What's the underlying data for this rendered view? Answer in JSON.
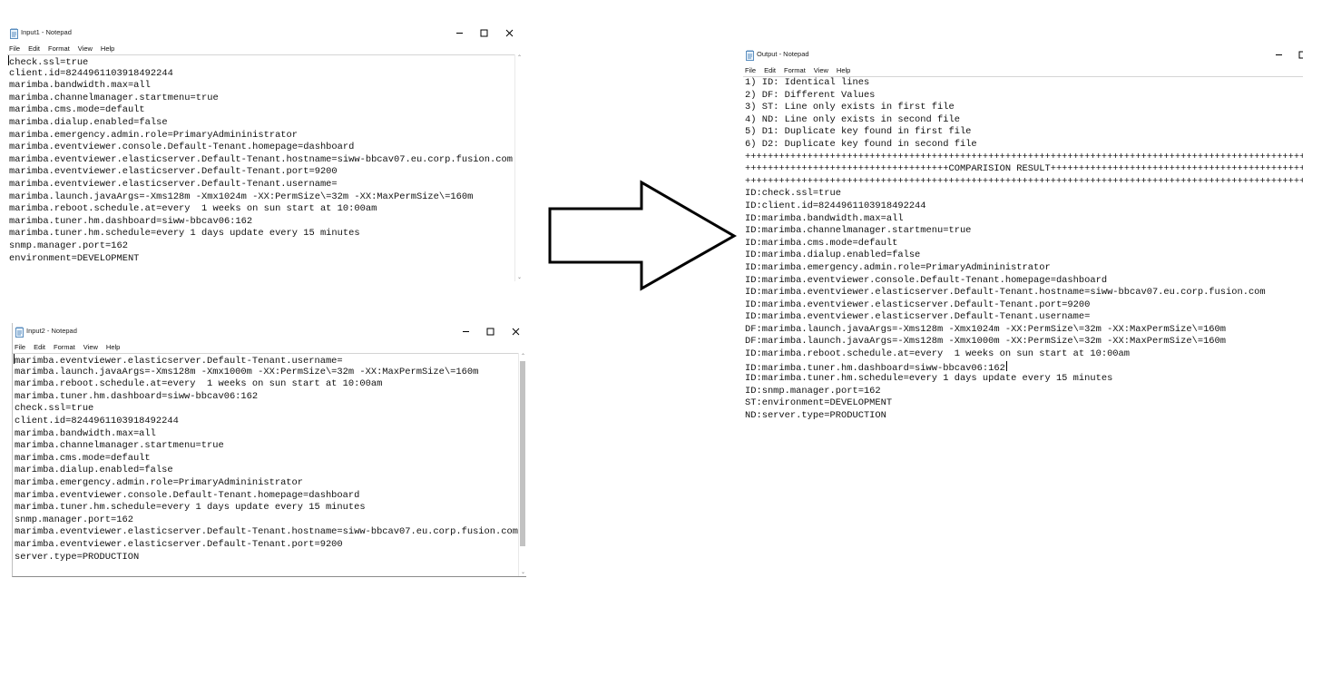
{
  "input1": {
    "title": "Input1 - Notepad",
    "menu": [
      "File",
      "Edit",
      "Format",
      "View",
      "Help"
    ],
    "lines": [
      "check.ssl=true",
      "client.id=8244961103918492244",
      "marimba.bandwidth.max=all",
      "marimba.channelmanager.startmenu=true",
      "marimba.cms.mode=default",
      "marimba.dialup.enabled=false",
      "marimba.emergency.admin.role=PrimaryAdmininistrator",
      "marimba.eventviewer.console.Default-Tenant.homepage=dashboard",
      "marimba.eventviewer.elasticserver.Default-Tenant.hostname=siww-bbcav07.eu.corp.fusion.com",
      "marimba.eventviewer.elasticserver.Default-Tenant.port=9200",
      "marimba.eventviewer.elasticserver.Default-Tenant.username=",
      "marimba.launch.javaArgs=-Xms128m -Xmx1024m -XX:PermSize\\=32m -XX:MaxPermSize\\=160m",
      "marimba.reboot.schedule.at=every  1 weeks on sun start at 10:00am",
      "marimba.tuner.hm.dashboard=siww-bbcav06:162",
      "marimba.tuner.hm.schedule=every 1 days update every 15 minutes",
      "snmp.manager.port=162",
      "environment=DEVELOPMENT"
    ]
  },
  "input2": {
    "title": "Input2 - Notepad",
    "menu": [
      "File",
      "Edit",
      "Format",
      "View",
      "Help"
    ],
    "lines": [
      "marimba.eventviewer.elasticserver.Default-Tenant.username=",
      "marimba.launch.javaArgs=-Xms128m -Xmx1000m -XX:PermSize\\=32m -XX:MaxPermSize\\=160m",
      "marimba.reboot.schedule.at=every  1 weeks on sun start at 10:00am",
      "marimba.tuner.hm.dashboard=siww-bbcav06:162",
      "check.ssl=true",
      "client.id=8244961103918492244",
      "marimba.bandwidth.max=all",
      "marimba.channelmanager.startmenu=true",
      "marimba.cms.mode=default",
      "marimba.dialup.enabled=false",
      "marimba.emergency.admin.role=PrimaryAdmininistrator",
      "marimba.eventviewer.console.Default-Tenant.homepage=dashboard",
      "marimba.tuner.hm.schedule=every 1 days update every 15 minutes",
      "snmp.manager.port=162",
      "marimba.eventviewer.elasticserver.Default-Tenant.hostname=siww-bbcav07.eu.corp.fusion.com",
      "marimba.eventviewer.elasticserver.Default-Tenant.port=9200",
      "server.type=PRODUCTION"
    ]
  },
  "output": {
    "title": "Output - Notepad",
    "menu": [
      "File",
      "Edit",
      "Format",
      "View",
      "Help"
    ],
    "lines": [
      "1) ID: Identical lines",
      "2) DF: Different Values",
      "3) ST: Line only exists in first file",
      "4) ND: Line only exists in second file",
      "5) D1: Duplicate key found in first file",
      "6) D2: Duplicate key found in second file",
      "++++++++++++++++++++++++++++++++++++++++++++++++++++++++++++++++++++++++++++++++++++++++++++++++++++",
      "++++++++++++++++++++++++++++++++++++COMPARISION RESULT+++++++++++++++++++++++++++++++++++++++++++++++",
      "++++++++++++++++++++++++++++++++++++++++++++++++++++++++++++++++++++++++++++++++++++++++++++++++++++",
      "ID:check.ssl=true",
      "ID:client.id=8244961103918492244",
      "ID:marimba.bandwidth.max=all",
      "ID:marimba.channelmanager.startmenu=true",
      "ID:marimba.cms.mode=default",
      "ID:marimba.dialup.enabled=false",
      "ID:marimba.emergency.admin.role=PrimaryAdmininistrator",
      "ID:marimba.eventviewer.console.Default-Tenant.homepage=dashboard",
      "ID:marimba.eventviewer.elasticserver.Default-Tenant.hostname=siww-bbcav07.eu.corp.fusion.com",
      "ID:marimba.eventviewer.elasticserver.Default-Tenant.port=9200",
      "ID:marimba.eventviewer.elasticserver.Default-Tenant.username=",
      "DF:marimba.launch.javaArgs=-Xms128m -Xmx1024m -XX:PermSize\\=32m -XX:MaxPermSize\\=160m",
      "DF:marimba.launch.javaArgs=-Xms128m -Xmx1000m -XX:PermSize\\=32m -XX:MaxPermSize\\=160m",
      "ID:marimba.reboot.schedule.at=every  1 weeks on sun start at 10:00am",
      "ID:marimba.tuner.hm.dashboard=siww-bbcav06:162",
      "ID:marimba.tuner.hm.schedule=every 1 days update every 15 minutes",
      "ID:snmp.manager.port=162",
      "ST:environment=DEVELOPMENT",
      "ND:server.type=PRODUCTION"
    ]
  },
  "icons": {
    "window_icon": "notepad-icon",
    "minimize": "minimize-icon",
    "maximize": "maximize-icon",
    "close": "close-icon",
    "flow": "right-arrow-icon"
  },
  "colors": {
    "text": "#111111",
    "scroll_thumb": "#c2c2c2",
    "arrow_stroke": "#000000"
  }
}
